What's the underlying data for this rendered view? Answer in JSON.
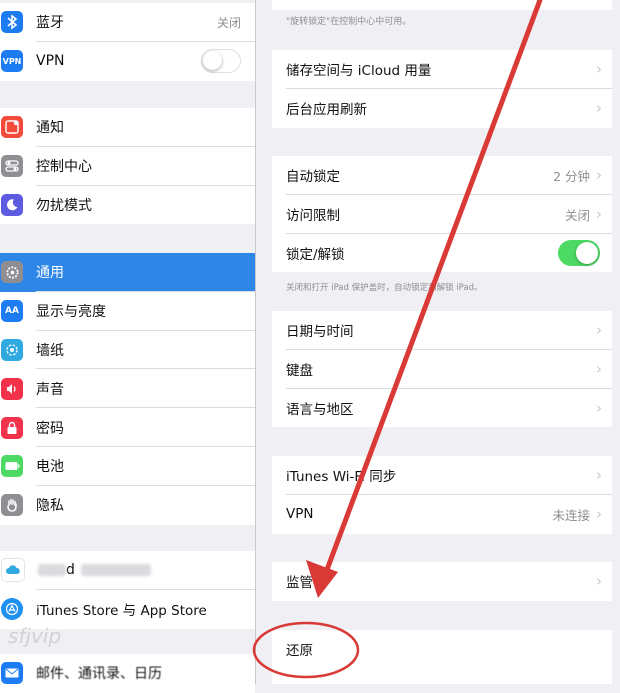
{
  "sidebar": {
    "group1": [
      {
        "label": "蓝牙",
        "value": "关闭",
        "icon": "bluetooth-icon",
        "color": "#1e7cf2"
      },
      {
        "label": "VPN",
        "icon": "vpn-icon",
        "color": "#1e7cf2",
        "toggle": false
      }
    ],
    "group2": [
      {
        "label": "通知",
        "icon": "notifications-icon",
        "color": "#f24b3b"
      },
      {
        "label": "控制中心",
        "icon": "control-center-icon",
        "color": "#8e8e93"
      },
      {
        "label": "勿扰模式",
        "icon": "moon-icon",
        "color": "#5d5ce0"
      }
    ],
    "group3": [
      {
        "label": "通用",
        "icon": "gear-icon",
        "color": "#8e8e93",
        "selected": true
      },
      {
        "label": "显示与亮度",
        "icon": "display-icon",
        "color": "#1e7cf2"
      },
      {
        "label": "墙纸",
        "icon": "wallpaper-icon",
        "color": "#2fa9e0"
      },
      {
        "label": "声音",
        "icon": "sound-icon",
        "color": "#f2324b"
      },
      {
        "label": "密码",
        "icon": "lock-icon",
        "color": "#f2324b"
      },
      {
        "label": "电池",
        "icon": "battery-icon",
        "color": "#4cd964"
      },
      {
        "label": "隐私",
        "icon": "hand-icon",
        "color": "#8e8e93"
      }
    ],
    "group4": [
      {
        "label": "d",
        "icon": "icloud-icon",
        "color": "#2fa9e0"
      },
      {
        "label": "iTunes Store 与 App Store",
        "icon": "appstore-icon",
        "color": "#1e90f0"
      }
    ],
    "group5": [
      {
        "label": "邮件、通讯录、日历",
        "icon": "mail-icon",
        "color": "#1e7cf2"
      }
    ]
  },
  "main": {
    "top_note": "\"旋转锁定\"在控制中心中可用。",
    "group1": [
      {
        "label": "储存空间与 iCloud 用量"
      },
      {
        "label": "后台应用刷新"
      }
    ],
    "group2": [
      {
        "label": "自动锁定",
        "value": "2 分钟"
      },
      {
        "label": "访问限制",
        "value": "关闭"
      },
      {
        "label": "锁定/解锁",
        "toggle": true
      }
    ],
    "lock_note": "关闭和打开 iPad 保护盖时，自动锁定和解锁 iPad。",
    "group3": [
      {
        "label": "日期与时间"
      },
      {
        "label": "键盘"
      },
      {
        "label": "语言与地区"
      }
    ],
    "group4": [
      {
        "label": "iTunes Wi-Fi 同步"
      },
      {
        "label": "VPN",
        "value": "未连接"
      }
    ],
    "group5": [
      {
        "label": "监管"
      }
    ],
    "group6": [
      {
        "label": "还原"
      }
    ],
    "chevron": "›"
  },
  "watermark": "sfjvip",
  "annotation_color": "#d93a36"
}
